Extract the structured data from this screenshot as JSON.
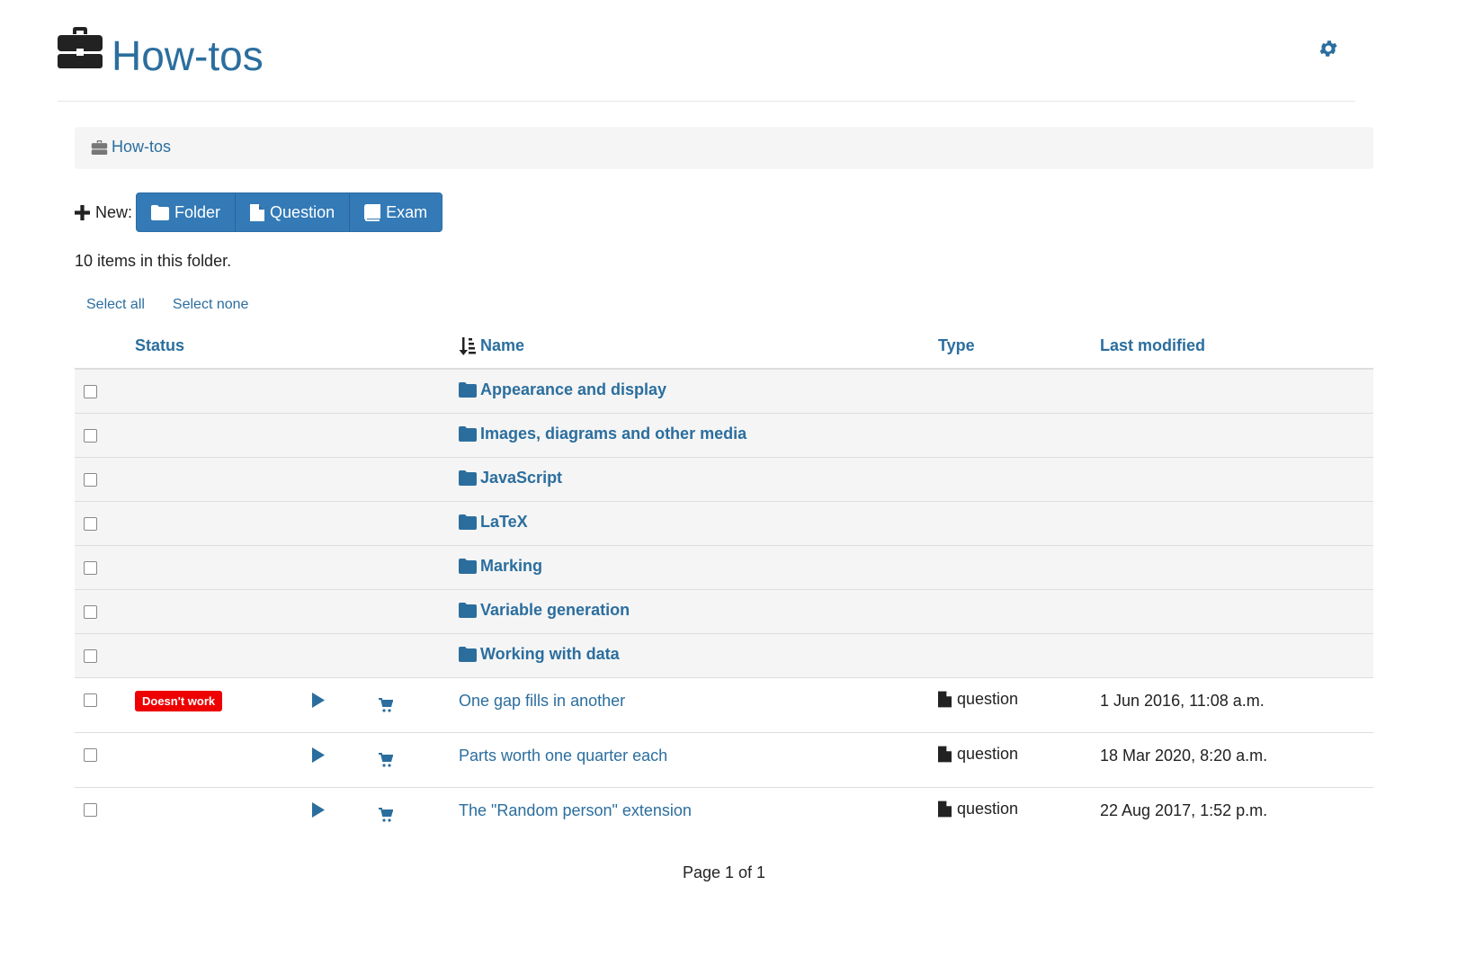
{
  "header": {
    "title": "How-tos"
  },
  "breadcrumb": {
    "label": "How-tos"
  },
  "new_bar": {
    "label": "New:",
    "buttons": [
      {
        "label": "Folder",
        "icon": "folder-icon"
      },
      {
        "label": "Question",
        "icon": "file-icon"
      },
      {
        "label": "Exam",
        "icon": "book-icon"
      }
    ]
  },
  "count_text": "10 items in this folder.",
  "select": {
    "all": "Select all",
    "none": "Select none"
  },
  "columns": {
    "status": "Status",
    "name": "Name",
    "type": "Type",
    "modified": "Last modified"
  },
  "folders": [
    {
      "name": "Appearance and display"
    },
    {
      "name": "Images, diagrams and other media"
    },
    {
      "name": "JavaScript"
    },
    {
      "name": "LaTeX"
    },
    {
      "name": "Marking"
    },
    {
      "name": "Variable generation"
    },
    {
      "name": "Working with data"
    }
  ],
  "questions": [
    {
      "status": "Doesn't work",
      "name": "One gap fills in another",
      "type": "question",
      "modified": "1 Jun 2016, 11:08 a.m."
    },
    {
      "status": "",
      "name": "Parts worth one quarter each",
      "type": "question",
      "modified": "18 Mar 2020, 8:20 a.m."
    },
    {
      "status": "",
      "name": "The \"Random person\" extension",
      "type": "question",
      "modified": "22 Aug 2017, 1:52 p.m."
    }
  ],
  "pagination": "Page 1 of 1",
  "colors": {
    "link": "#2b6e9e",
    "button": "#337ab7",
    "badge": "#ee0000"
  }
}
